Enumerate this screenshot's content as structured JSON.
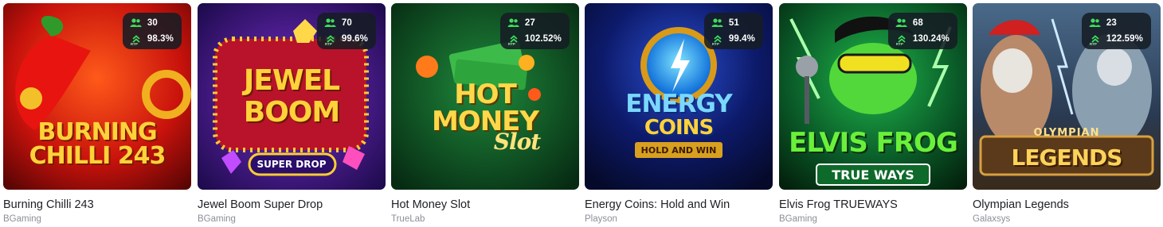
{
  "rtp_label": "RTP",
  "colors": {
    "badge_bg": "#161c24",
    "players_icon": "#3ddc5c",
    "rtp_icon": "#3ddc5c",
    "title": "#1d1f24",
    "provider": "#8a8f98"
  },
  "games": [
    {
      "title": "Burning Chilli 243",
      "provider": "BGaming",
      "players": "30",
      "rtp": "98.3%",
      "logo_lines": [
        "BURNING",
        "CHILLI 243"
      ]
    },
    {
      "title": "Jewel Boom Super Drop",
      "provider": "BGaming",
      "players": "70",
      "rtp": "99.6%",
      "logo_lines": [
        "JEWEL",
        "BOOM",
        "SUPER DROP"
      ]
    },
    {
      "title": "Hot Money Slot",
      "provider": "TrueLab",
      "players": "27",
      "rtp": "102.52%",
      "logo_lines": [
        "HOT",
        "MONEY",
        "Slot"
      ]
    },
    {
      "title": "Energy Coins: Hold and Win",
      "provider": "Playson",
      "players": "51",
      "rtp": "99.4%",
      "logo_lines": [
        "ENERGY",
        "COINS",
        "HOLD AND WIN"
      ]
    },
    {
      "title": "Elvis Frog TRUEWAYS",
      "provider": "BGaming",
      "players": "68",
      "rtp": "130.24%",
      "logo_lines": [
        "ELVIS FROG",
        "TRUE WAYS"
      ]
    },
    {
      "title": "Olympian Legends",
      "provider": "Galaxsys",
      "players": "23",
      "rtp": "122.59%",
      "logo_lines": [
        "OLYMPIAN",
        "LEGENDS"
      ]
    }
  ]
}
